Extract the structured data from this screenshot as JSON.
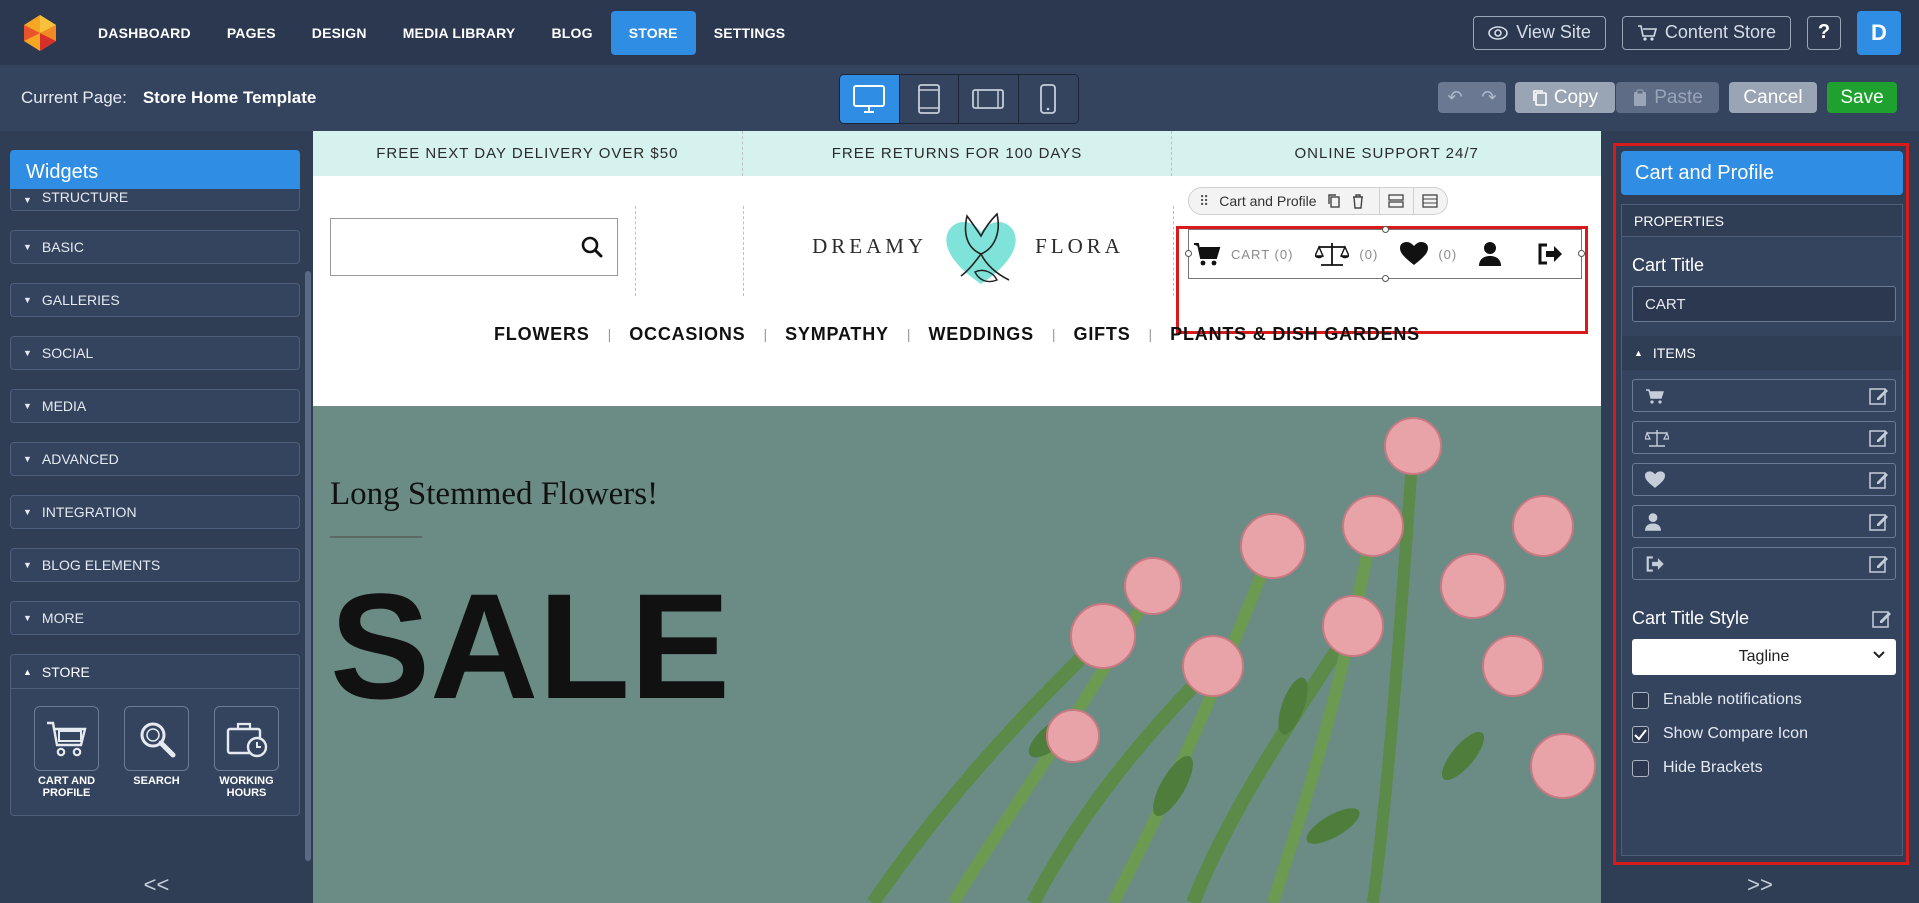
{
  "topnav": {
    "items": [
      "DASHBOARD",
      "PAGES",
      "DESIGN",
      "MEDIA LIBRARY",
      "BLOG",
      "STORE",
      "SETTINGS"
    ],
    "active": "STORE",
    "view_site": "View Site",
    "content_store": "Content Store",
    "help": "?",
    "user_initial": "D"
  },
  "subbar": {
    "current_page_label": "Current Page:",
    "current_page_value": "Store Home Template",
    "copy": "Copy",
    "paste": "Paste",
    "cancel": "Cancel",
    "save": "Save"
  },
  "left": {
    "title": "Widgets",
    "categories": [
      "STRUCTURE",
      "BASIC",
      "GALLERIES",
      "SOCIAL",
      "MEDIA",
      "ADVANCED",
      "INTEGRATION",
      "BLOG ELEMENTS",
      "MORE"
    ],
    "store_category": "STORE",
    "store_widgets": [
      {
        "label": "CART AND PROFILE",
        "icon": "cart-icon"
      },
      {
        "label": "SEARCH",
        "icon": "search-icon"
      },
      {
        "label": "WORKING HOURS",
        "icon": "briefcase-clock-icon"
      }
    ],
    "collapse": "<<"
  },
  "canvas": {
    "promo": [
      "FREE NEXT DAY DELIVERY OVER $50",
      "FREE RETURNS FOR 100 DAYS",
      "ONLINE SUPPORT 24/7"
    ],
    "brand_left": "DREAMY",
    "brand_right": "FLORA",
    "toolbar_chip": "Cart and Profile",
    "cart_label": "CART (0)",
    "compare_count": "(0)",
    "wishlist_count": "(0)",
    "menu": [
      "FLOWERS",
      "OCCASIONS",
      "SYMPATHY",
      "WEDDINGS",
      "GIFTS",
      "PLANTS & DISH GARDENS"
    ],
    "hero_title": "Long Stemmed Flowers!",
    "hero_big": "SALE"
  },
  "right": {
    "title": "Cart and Profile",
    "properties": "PROPERTIES",
    "cart_title_label": "Cart Title",
    "cart_title_value": "CART",
    "items_label": "ITEMS",
    "items": [
      "cart-icon",
      "compare-icon",
      "heart-icon",
      "user-icon",
      "logout-icon"
    ],
    "style_label": "Cart Title Style",
    "style_value": "Tagline",
    "checkboxes": [
      {
        "label": "Enable notifications",
        "checked": false
      },
      {
        "label": "Show Compare Icon",
        "checked": true
      },
      {
        "label": "Hide Brackets",
        "checked": false
      }
    ],
    "collapse": ">>"
  },
  "colors": {
    "accent": "#2f8de4",
    "save": "#1ea12f",
    "selection": "#d81a1a",
    "promo_bg": "#d6f2ef"
  }
}
